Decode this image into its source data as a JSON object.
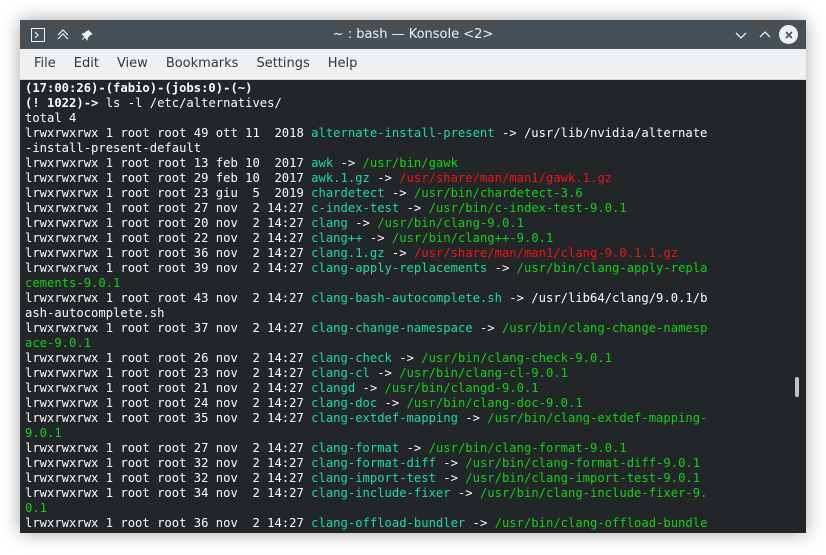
{
  "window": {
    "title": "~ : bash — Konsole <2>",
    "icons": {
      "app_icon": "terminal-icon",
      "keep_above": "keep-above-icon",
      "pin": "pin-icon",
      "minimize": "chevron-down-icon",
      "maximize": "chevron-up-icon",
      "close": "close-icon"
    }
  },
  "menubar": {
    "items": [
      "File",
      "Edit",
      "View",
      "Bookmarks",
      "Settings",
      "Help"
    ]
  },
  "colors": {
    "link": "#1cdc9a",
    "target": "#11d116",
    "archive": "#ed1515",
    "text": "#fcfcfc",
    "background": "#232629"
  },
  "terminal": {
    "lines": [
      [
        {
          "t": "(17:00:26)-(fabio)-(jobs:0)-(~)",
          "c": "bold"
        }
      ],
      [
        {
          "t": "(! 1022)-> ",
          "c": "bold"
        },
        {
          "t": "ls -l /etc/alternatives/",
          "c": "text"
        }
      ],
      [
        {
          "t": "total 4",
          "c": "text"
        }
      ],
      [
        {
          "t": "lrwxrwxrwx 1 root root 49 ott 11  2018 ",
          "c": "text"
        },
        {
          "t": "alternate-install-present",
          "c": "link"
        },
        {
          "t": " -> /usr/lib/nvidia/alternate",
          "c": "text"
        }
      ],
      [
        {
          "t": "-install-present-default",
          "c": "text"
        }
      ],
      [
        {
          "t": "lrwxrwxrwx 1 root root 13 feb 10  2017 ",
          "c": "text"
        },
        {
          "t": "awk",
          "c": "link"
        },
        {
          "t": " -> ",
          "c": "text"
        },
        {
          "t": "/usr/bin/gawk",
          "c": "target"
        }
      ],
      [
        {
          "t": "lrwxrwxrwx 1 root root 29 feb 10  2017 ",
          "c": "text"
        },
        {
          "t": "awk.1.gz",
          "c": "link"
        },
        {
          "t": " -> ",
          "c": "text"
        },
        {
          "t": "/usr/share/man/man1/gawk.1.gz",
          "c": "archive"
        }
      ],
      [
        {
          "t": "lrwxrwxrwx 1 root root 23 giu  5  2019 ",
          "c": "text"
        },
        {
          "t": "chardetect",
          "c": "link"
        },
        {
          "t": " -> ",
          "c": "text"
        },
        {
          "t": "/usr/bin/chardetect-3.6",
          "c": "target"
        }
      ],
      [
        {
          "t": "lrwxrwxrwx 1 root root 27 nov  2 14:27 ",
          "c": "text"
        },
        {
          "t": "c-index-test",
          "c": "link"
        },
        {
          "t": " -> ",
          "c": "text"
        },
        {
          "t": "/usr/bin/c-index-test-9.0.1",
          "c": "target"
        }
      ],
      [
        {
          "t": "lrwxrwxrwx 1 root root 20 nov  2 14:27 ",
          "c": "text"
        },
        {
          "t": "clang",
          "c": "link"
        },
        {
          "t": " -> ",
          "c": "text"
        },
        {
          "t": "/usr/bin/clang-9.0.1",
          "c": "target"
        }
      ],
      [
        {
          "t": "lrwxrwxrwx 1 root root 22 nov  2 14:27 ",
          "c": "text"
        },
        {
          "t": "clang++",
          "c": "link"
        },
        {
          "t": " -> ",
          "c": "text"
        },
        {
          "t": "/usr/bin/clang++-9.0.1",
          "c": "target"
        }
      ],
      [
        {
          "t": "lrwxrwxrwx 1 root root 36 nov  2 14:27 ",
          "c": "text"
        },
        {
          "t": "clang.1.gz",
          "c": "link"
        },
        {
          "t": " -> ",
          "c": "text"
        },
        {
          "t": "/usr/share/man/man1/clang-9.0.1.1.gz",
          "c": "archive"
        }
      ],
      [
        {
          "t": "lrwxrwxrwx 1 root root 39 nov  2 14:27 ",
          "c": "text"
        },
        {
          "t": "clang-apply-replacements",
          "c": "link"
        },
        {
          "t": " -> ",
          "c": "text"
        },
        {
          "t": "/usr/bin/clang-apply-repla",
          "c": "target"
        }
      ],
      [
        {
          "t": "cements-9.0.1",
          "c": "target"
        }
      ],
      [
        {
          "t": "lrwxrwxrwx 1 root root 43 nov  2 14:27 ",
          "c": "text"
        },
        {
          "t": "clang-bash-autocomplete.sh",
          "c": "link"
        },
        {
          "t": " -> /usr/lib64/clang/9.0.1/b",
          "c": "text"
        }
      ],
      [
        {
          "t": "ash-autocomplete.sh",
          "c": "text"
        }
      ],
      [
        {
          "t": "lrwxrwxrwx 1 root root 37 nov  2 14:27 ",
          "c": "text"
        },
        {
          "t": "clang-change-namespace",
          "c": "link"
        },
        {
          "t": " -> ",
          "c": "text"
        },
        {
          "t": "/usr/bin/clang-change-namesp",
          "c": "target"
        }
      ],
      [
        {
          "t": "ace-9.0.1",
          "c": "target"
        }
      ],
      [
        {
          "t": "lrwxrwxrwx 1 root root 26 nov  2 14:27 ",
          "c": "text"
        },
        {
          "t": "clang-check",
          "c": "link"
        },
        {
          "t": " -> ",
          "c": "text"
        },
        {
          "t": "/usr/bin/clang-check-9.0.1",
          "c": "target"
        }
      ],
      [
        {
          "t": "lrwxrwxrwx 1 root root 23 nov  2 14:27 ",
          "c": "text"
        },
        {
          "t": "clang-cl",
          "c": "link"
        },
        {
          "t": " -> ",
          "c": "text"
        },
        {
          "t": "/usr/bin/clang-cl-9.0.1",
          "c": "target"
        }
      ],
      [
        {
          "t": "lrwxrwxrwx 1 root root 21 nov  2 14:27 ",
          "c": "text"
        },
        {
          "t": "clangd",
          "c": "link"
        },
        {
          "t": " -> ",
          "c": "text"
        },
        {
          "t": "/usr/bin/clangd-9.0.1",
          "c": "target"
        }
      ],
      [
        {
          "t": "lrwxrwxrwx 1 root root 24 nov  2 14:27 ",
          "c": "text"
        },
        {
          "t": "clang-doc",
          "c": "link"
        },
        {
          "t": " -> ",
          "c": "text"
        },
        {
          "t": "/usr/bin/clang-doc-9.0.1",
          "c": "target"
        }
      ],
      [
        {
          "t": "lrwxrwxrwx 1 root root 35 nov  2 14:27 ",
          "c": "text"
        },
        {
          "t": "clang-extdef-mapping",
          "c": "link"
        },
        {
          "t": " -> ",
          "c": "text"
        },
        {
          "t": "/usr/bin/clang-extdef-mapping-",
          "c": "target"
        }
      ],
      [
        {
          "t": "9.0.1",
          "c": "target"
        }
      ],
      [
        {
          "t": "lrwxrwxrwx 1 root root 27 nov  2 14:27 ",
          "c": "text"
        },
        {
          "t": "clang-format",
          "c": "link"
        },
        {
          "t": " -> ",
          "c": "text"
        },
        {
          "t": "/usr/bin/clang-format-9.0.1",
          "c": "target"
        }
      ],
      [
        {
          "t": "lrwxrwxrwx 1 root root 32 nov  2 14:27 ",
          "c": "text"
        },
        {
          "t": "clang-format-diff",
          "c": "link"
        },
        {
          "t": " -> ",
          "c": "text"
        },
        {
          "t": "/usr/bin/clang-format-diff-9.0.1",
          "c": "target"
        }
      ],
      [
        {
          "t": "lrwxrwxrwx 1 root root 32 nov  2 14:27 ",
          "c": "text"
        },
        {
          "t": "clang-import-test",
          "c": "link"
        },
        {
          "t": " -> ",
          "c": "text"
        },
        {
          "t": "/usr/bin/clang-import-test-9.0.1",
          "c": "target"
        }
      ],
      [
        {
          "t": "lrwxrwxrwx 1 root root 34 nov  2 14:27 ",
          "c": "text"
        },
        {
          "t": "clang-include-fixer",
          "c": "link"
        },
        {
          "t": " -> ",
          "c": "text"
        },
        {
          "t": "/usr/bin/clang-include-fixer-9.",
          "c": "target"
        }
      ],
      [
        {
          "t": "0.1",
          "c": "target"
        }
      ],
      [
        {
          "t": "lrwxrwxrwx 1 root root 36 nov  2 14:27 ",
          "c": "text"
        },
        {
          "t": "clang-offload-bundler",
          "c": "link"
        },
        {
          "t": " -> ",
          "c": "text"
        },
        {
          "t": "/usr/bin/clang-offload-bundle",
          "c": "target"
        }
      ]
    ]
  }
}
